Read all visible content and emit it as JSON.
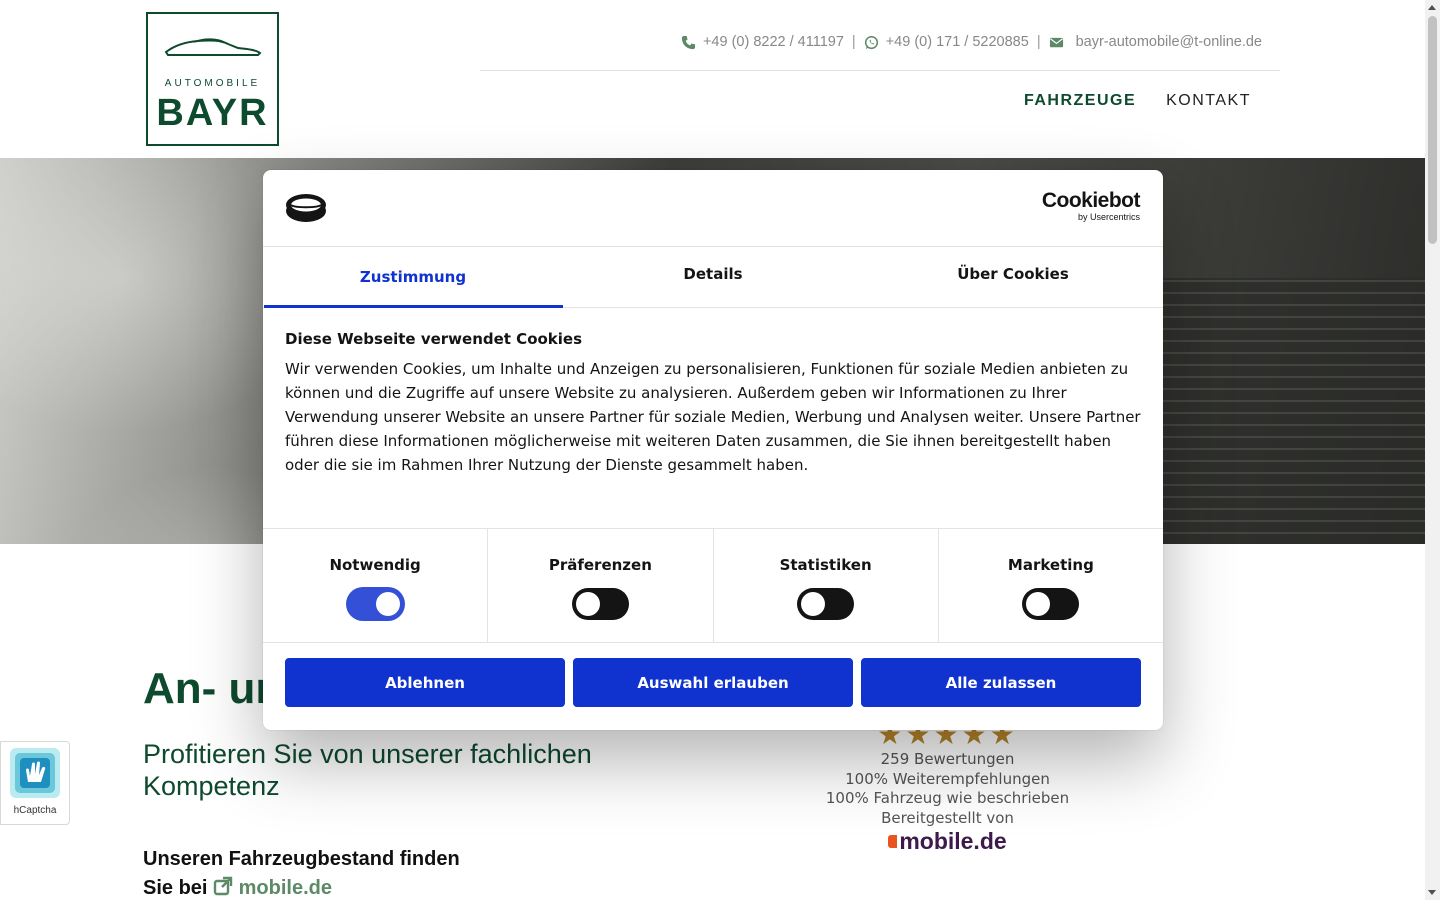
{
  "site": {
    "logo": {
      "top_text": "AUTOMOBILE",
      "main_text": "BAYR"
    },
    "contact": {
      "phone": "+49 (0) 8222 / 411197",
      "whatsapp": "+49 (0) 171 / 5220885",
      "email": "bayr-automobile@t-online.de",
      "separator": "|"
    },
    "nav": [
      {
        "label": "FAHRZEUGE",
        "active": true
      },
      {
        "label": "KONTAKT",
        "active": false
      }
    ]
  },
  "content": {
    "headline_visible": "An- ur",
    "subline": "Profitieren Sie von unserer fachlichen Kompetenz",
    "find_line1": "Unseren Fahrzeugbestand finden",
    "find_line2_prefix": "Sie bei",
    "find_link": "mobile.de",
    "ratings": {
      "stars": "★★★★★",
      "count": "259 Bewertungen",
      "recommend": "100% Weiterempfehlungen",
      "as_described": "100% Fahrzeug wie beschrieben",
      "provided_by": "Bereitgestellt von",
      "provider_logo": "mobile.de"
    },
    "hcaptcha_label": "hCaptcha"
  },
  "cookie_dialog": {
    "brand_main": "Cookiebot",
    "brand_sub": "by Usercentrics",
    "tabs": [
      {
        "label": "Zustimmung",
        "active": true
      },
      {
        "label": "Details",
        "active": false
      },
      {
        "label": "Über Cookies",
        "active": false
      }
    ],
    "title": "Diese Webseite verwendet Cookies",
    "text": "Wir verwenden Cookies, um Inhalte und Anzeigen zu personalisieren, Funktionen für soziale Medien anbieten zu können und die Zugriffe auf unsere Website zu analysieren. Außerdem geben wir Informationen zu Ihrer Verwendung unserer Website an unsere Partner für soziale Medien, Werbung und Analysen weiter. Unsere Partner führen diese Informationen möglicherweise mit weiteren Daten zusammen, die Sie ihnen bereitgestellt haben oder die sie im Rahmen Ihrer Nutzung der Dienste gesammelt haben.",
    "categories": [
      {
        "label": "Notwendig",
        "enabled": true
      },
      {
        "label": "Präferenzen",
        "enabled": false
      },
      {
        "label": "Statistiken",
        "enabled": false
      },
      {
        "label": "Marketing",
        "enabled": false
      }
    ],
    "buttons": {
      "decline": "Ablehnen",
      "allow_selection": "Auswahl erlauben",
      "allow_all": "Alle zulassen"
    }
  },
  "colors": {
    "brand_green": "#0e4a2e",
    "cookiebot_blue": "#1032cf",
    "star_gold": "#b8862a"
  }
}
